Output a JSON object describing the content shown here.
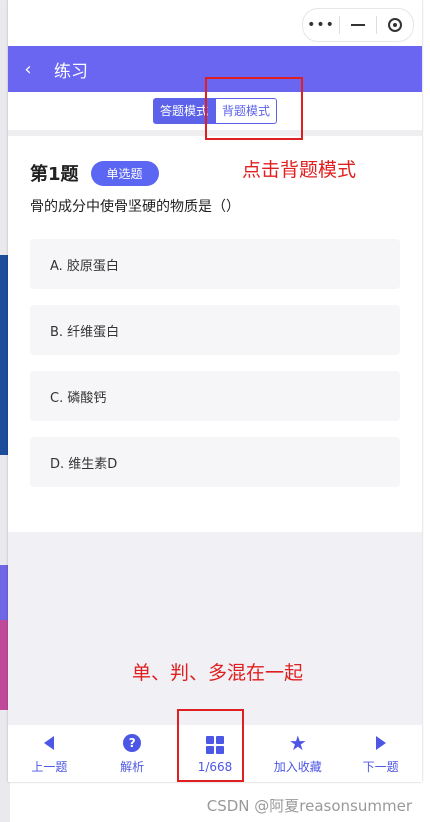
{
  "header": {
    "back_icon": "chevron-left-icon",
    "title": "练习"
  },
  "modes": {
    "answer_mode": "答题模式",
    "recite_mode": "背题模式"
  },
  "question": {
    "number_label": "第1题",
    "type_badge": "单选题",
    "text": "骨的成分中使骨坚硬的物质是（）",
    "options": [
      "A. 胶原蛋白",
      "B. 纤维蛋白",
      "C. 磷酸钙",
      "D. 维生素D"
    ]
  },
  "footer": {
    "prev": "上一题",
    "analysis": "解析",
    "progress": "1/668",
    "favorite": "加入收藏",
    "next": "下一题"
  },
  "annotations": {
    "recite_hint": "点击背题模式",
    "mixed_hint": "单、判、多混在一起"
  },
  "watermark": "CSDN @阿夏reasonsummer",
  "colors": {
    "accent": "#6a66f2",
    "annotation": "#e02020"
  }
}
